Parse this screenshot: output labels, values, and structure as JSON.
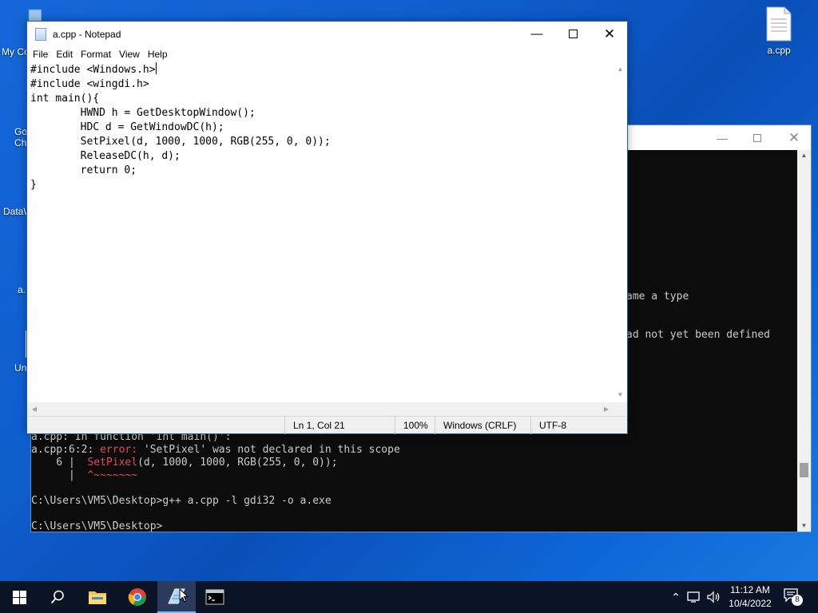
{
  "desktop": {
    "icons_left": [
      {
        "label": "My Co",
        "icon": "computer-icon"
      },
      {
        "label": "Go\nCh",
        "icon": "chrome-icon"
      },
      {
        "label": "DataW",
        "icon": "app-icon"
      },
      {
        "label": "a.",
        "icon": "file-icon"
      },
      {
        "label": "Un",
        "icon": "file-icon"
      }
    ],
    "icon_right": {
      "label": "a.cpp",
      "icon": "file-icon"
    }
  },
  "console": {
    "visible_fragments": [
      "ame a type",
      "ad not yet been defined"
    ],
    "lines": [
      "a.cpp: In function 'int main()':",
      "a.cpp:6:2: ",
      "    6 |  ",
      "      |  ",
      "",
      "C:\\Users\\VM5\\Desktop>g++ a.cpp -l gdi32 -o a.exe",
      "",
      "C:\\Users\\VM5\\Desktop>"
    ],
    "error_label": "error:",
    "error_message": " 'SetPixel' was not declared in this scope",
    "source_highlight": "SetPixel",
    "source_rest": "(d, 1000, 1000, RGB(255, 0, 0));",
    "squiggle": "^~~~~~~~"
  },
  "notepad": {
    "title": "a.cpp - Notepad",
    "menu": [
      "File",
      "Edit",
      "Format",
      "View",
      "Help"
    ],
    "code_lines": [
      "#include <Windows.h>",
      "#include <wingdi.h>",
      "int main(){",
      "        HWND h = GetDesktopWindow();",
      "        HDC d = GetWindowDC(h);",
      "        SetPixel(d, 1000, 1000, RGB(255, 0, 0));",
      "        ReleaseDC(h, d);",
      "        return 0;",
      "}"
    ],
    "status": {
      "position": "Ln 1, Col 21",
      "zoom": "100%",
      "line_ending": "Windows (CRLF)",
      "encoding": "UTF-8"
    }
  },
  "taskbar": {
    "apps": [
      "start-icon",
      "search-icon",
      "file-explorer-icon",
      "chrome-icon",
      "notepad-icon",
      "terminal-icon"
    ],
    "clock_time": "11:12 AM",
    "clock_date": "10/4/2022",
    "notification_count": "8"
  },
  "colors": {
    "error": "#e74856",
    "console_text": "#cccccc",
    "accent": "#1a5fb4"
  }
}
